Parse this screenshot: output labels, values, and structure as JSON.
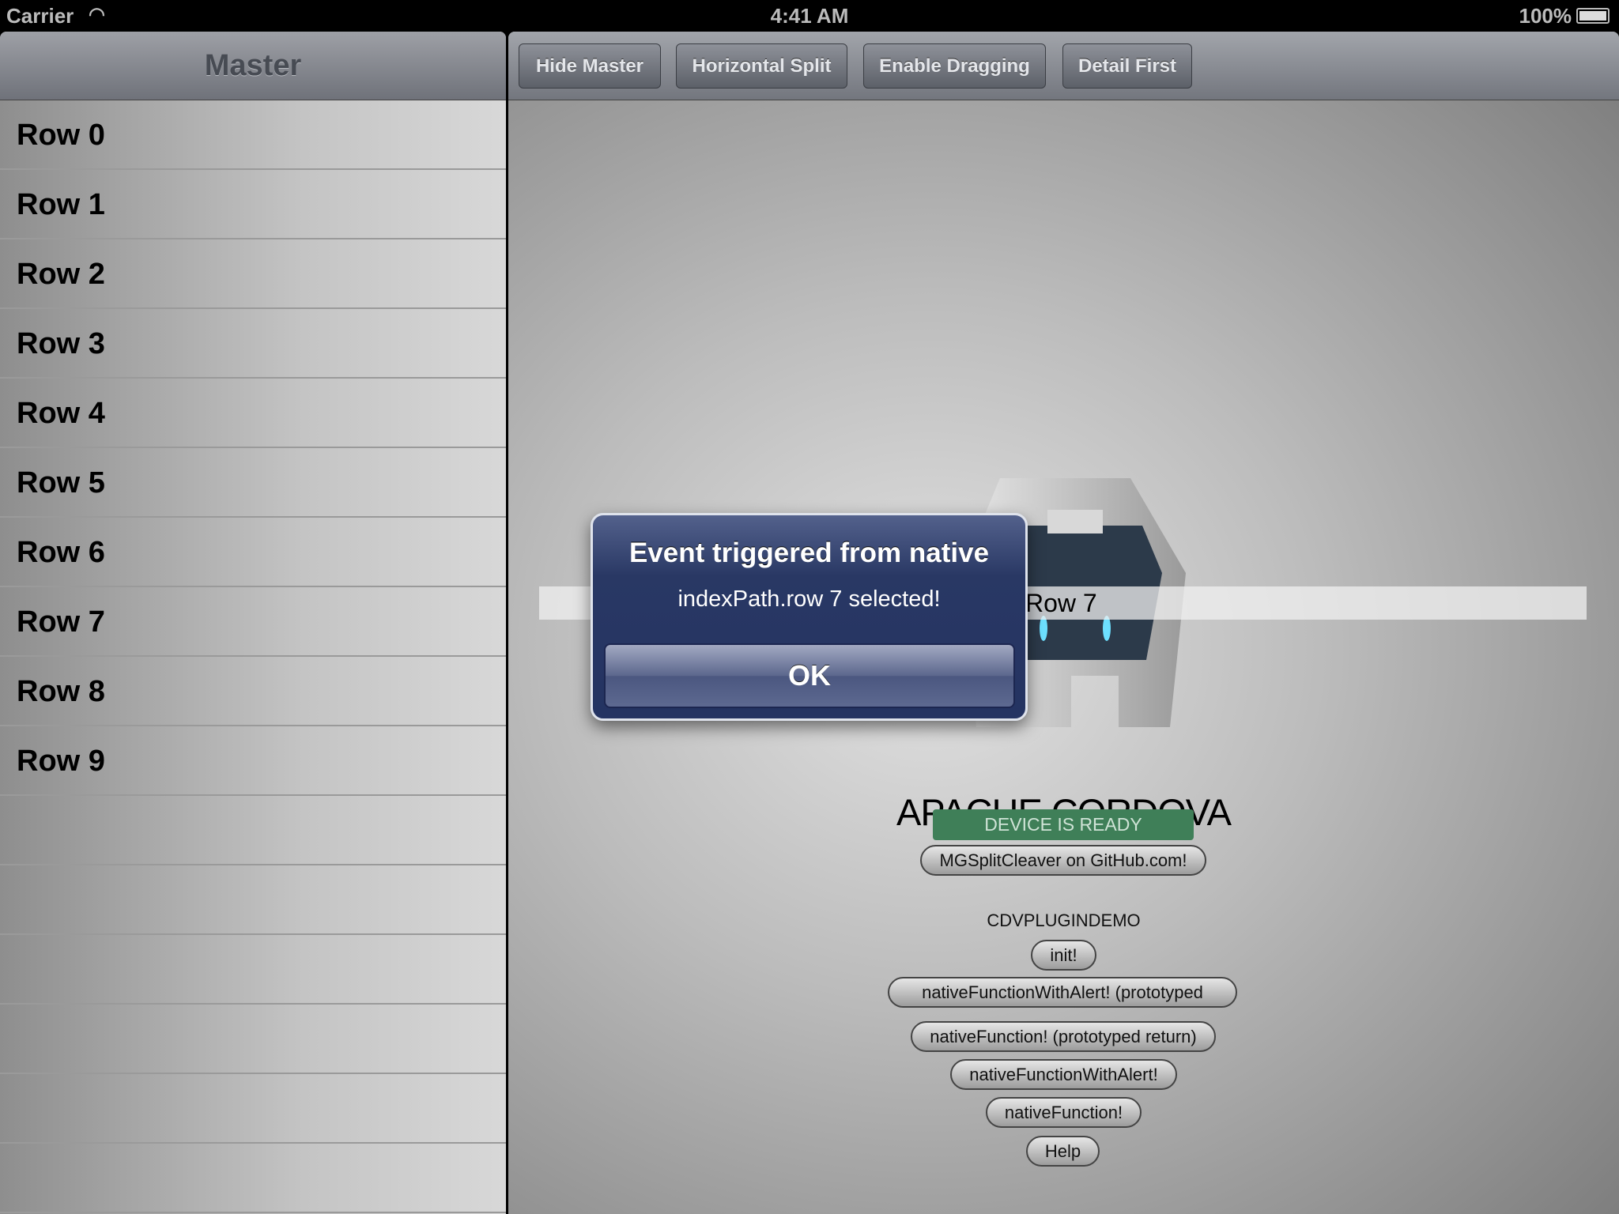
{
  "status": {
    "carrier": "Carrier",
    "time": "4:41 AM",
    "battery": "100%"
  },
  "master": {
    "title": "Master",
    "rows": [
      "Row 0",
      "Row 1",
      "Row 2",
      "Row 3",
      "Row 4",
      "Row 5",
      "Row 6",
      "Row 7",
      "Row 8",
      "Row 9"
    ]
  },
  "toolbar": {
    "hide_master": "Hide Master",
    "horizontal_split": "Horizontal Split",
    "enable_dragging": "Enable Dragging",
    "detail_first": "Detail First"
  },
  "detail": {
    "selected_row": "Row 7",
    "title": "APACHE CORDOVA",
    "device_ready": "DEVICE IS READY",
    "github_button": "MGSplitCleaver on GitHub.com!",
    "plugin_label": "CDVPLUGINDEMO",
    "buttons": [
      "init!",
      "nativeFunctionWithAlert! (prototyped return)",
      "nativeFunction! (prototyped return)",
      "nativeFunctionWithAlert!",
      "nativeFunction!",
      "Help"
    ]
  },
  "alert": {
    "title": "Event triggered from native",
    "message": "indexPath.row 7 selected!",
    "ok": "OK"
  },
  "colors": {
    "device_ready": "#3f7f58",
    "alert": "#293864"
  }
}
